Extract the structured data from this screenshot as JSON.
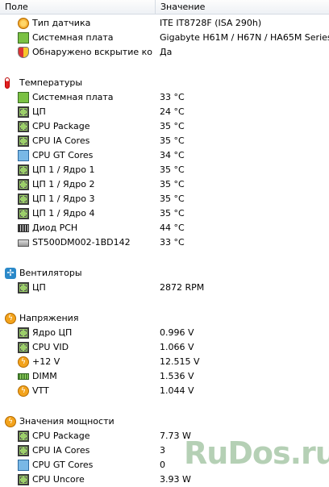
{
  "header": {
    "col_field": "Поле",
    "col_value": "Значение"
  },
  "rows": [
    {
      "label": "Тип датчика",
      "value": "ITE IT8728F  (ISA 290h)",
      "icon": "gauge-icon",
      "indent": 1
    },
    {
      "label": "Системная плата",
      "value": "Gigabyte H61M / H67N / HA65M Series",
      "icon": "motherboard-icon",
      "indent": 1
    },
    {
      "label": "Обнаружено вскрытие кор...",
      "value": "Да",
      "icon": "shield-icon",
      "indent": 1
    }
  ],
  "sections": [
    {
      "title": "Температуры",
      "icon": "thermometer-icon",
      "items": [
        {
          "label": "Системная плата",
          "value": "33 °C",
          "icon": "motherboard-icon"
        },
        {
          "label": "ЦП",
          "value": "24 °C",
          "icon": "cpu-icon"
        },
        {
          "label": "CPU Package",
          "value": "35 °C",
          "icon": "cpu-icon"
        },
        {
          "label": "CPU IA Cores",
          "value": "35 °C",
          "icon": "cpu-icon"
        },
        {
          "label": "CPU GT Cores",
          "value": "34 °C",
          "icon": "monitor-icon"
        },
        {
          "label": "ЦП 1 / Ядро 1",
          "value": "35 °C",
          "icon": "cpu-icon"
        },
        {
          "label": "ЦП 1 / Ядро 2",
          "value": "35 °C",
          "icon": "cpu-icon"
        },
        {
          "label": "ЦП 1 / Ядро 3",
          "value": "35 °C",
          "icon": "cpu-icon"
        },
        {
          "label": "ЦП 1 / Ядро 4",
          "value": "35 °C",
          "icon": "cpu-icon"
        },
        {
          "label": "Диод PCH",
          "value": "44 °C",
          "icon": "diode-icon"
        },
        {
          "label": "ST500DM002-1BD142",
          "value": "33 °C",
          "icon": "hdd-icon"
        }
      ]
    },
    {
      "title": "Вентиляторы",
      "icon": "fan-icon",
      "items": [
        {
          "label": "ЦП",
          "value": "2872 RPM",
          "icon": "cpu-icon"
        }
      ]
    },
    {
      "title": "Напряжения",
      "icon": "bolt-icon",
      "items": [
        {
          "label": "Ядро ЦП",
          "value": "0.996 V",
          "icon": "cpu-icon"
        },
        {
          "label": "CPU VID",
          "value": "1.066 V",
          "icon": "cpu-icon"
        },
        {
          "label": "+12 V",
          "value": "12.515 V",
          "icon": "bolt-icon"
        },
        {
          "label": "DIMM",
          "value": "1.536 V",
          "icon": "ram-icon"
        },
        {
          "label": "VTT",
          "value": "1.044 V",
          "icon": "bolt-icon"
        }
      ]
    },
    {
      "title": "Значения мощности",
      "icon": "bolt-icon",
      "items": [
        {
          "label": "CPU Package",
          "value": "7.73 W",
          "icon": "cpu-icon"
        },
        {
          "label": "CPU IA Cores",
          "value": "3",
          "icon": "cpu-icon"
        },
        {
          "label": "CPU GT Cores",
          "value": "0",
          "icon": "monitor-icon"
        },
        {
          "label": "CPU Uncore",
          "value": "3.93 W",
          "icon": "cpu-icon"
        }
      ]
    }
  ],
  "watermark": "RuDos.ru"
}
